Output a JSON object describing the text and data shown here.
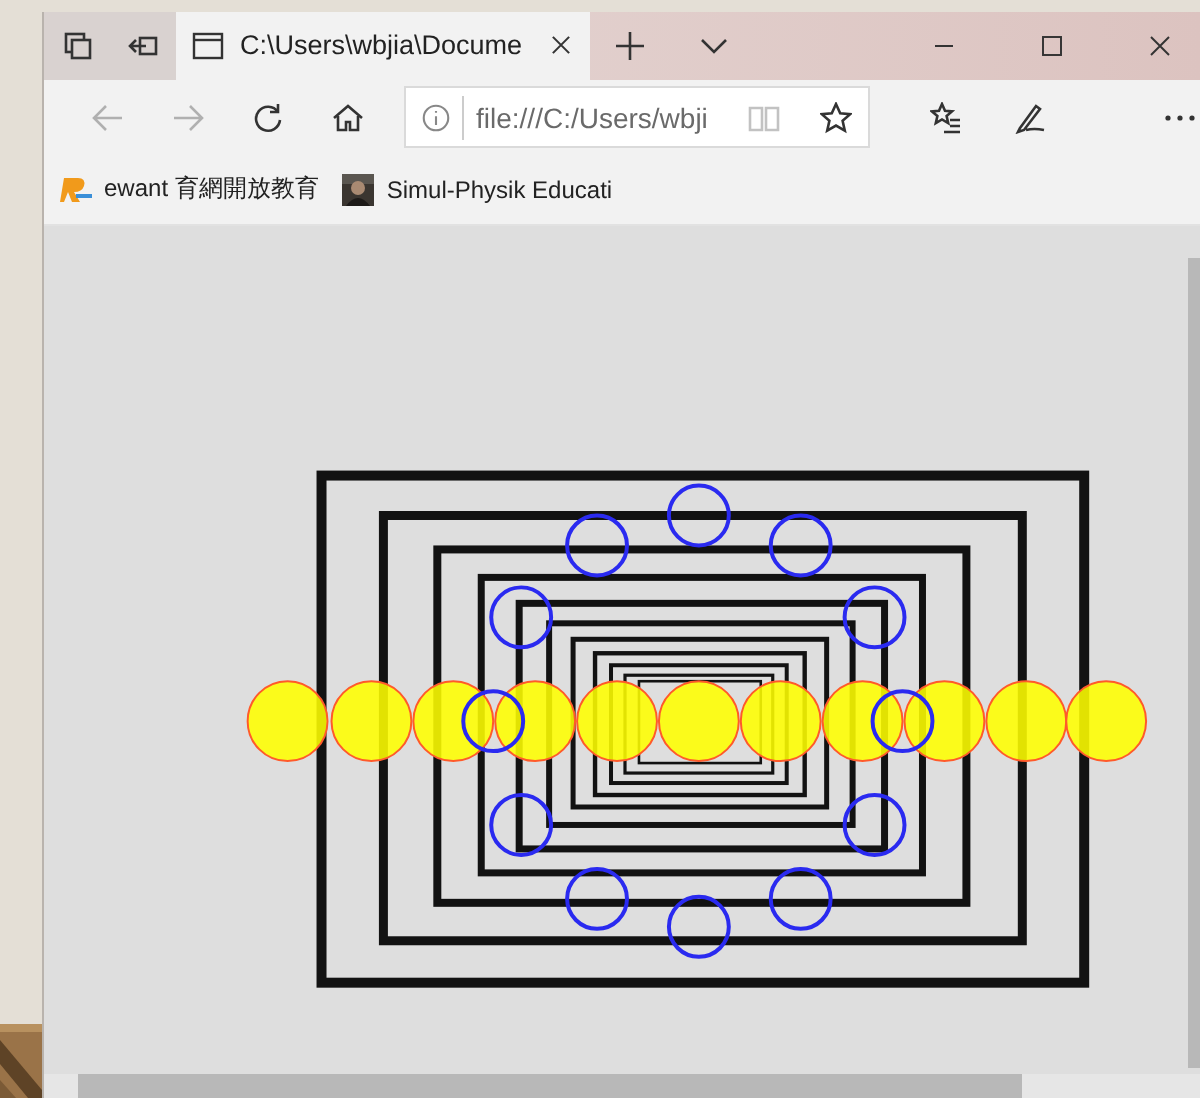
{
  "tabs": [
    {
      "title": "C:\\Users\\wbjia\\Docume",
      "selected": true
    }
  ],
  "navigation": {
    "back_disabled": true,
    "forward_disabled": true
  },
  "address_bar": {
    "value": "file:///C:/Users/wbji"
  },
  "bookmarks": [
    {
      "label": "ewant 育網開放教育",
      "kind": "logo"
    },
    {
      "label": "Simul-Physik Educati"
    }
  ]
}
